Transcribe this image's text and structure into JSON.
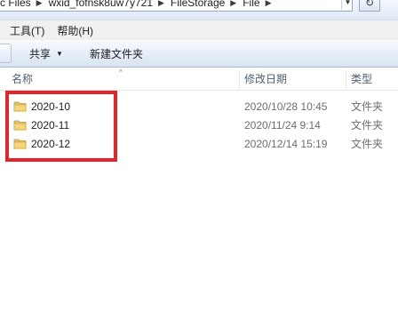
{
  "address": {
    "crumbs": [
      "c Files",
      "wxid_fofnsk8uw7y721",
      "FileStorage",
      "File"
    ],
    "dropdown_glyph": "▼",
    "refresh_glyph": "↻"
  },
  "menu": {
    "edge": "",
    "items": [
      "工具(T)",
      "帮助(H)"
    ]
  },
  "toolbar": {
    "share_label": "共享",
    "share_arrow": "▼",
    "new_folder_label": "新建文件夹"
  },
  "columns": {
    "name": "名称",
    "date": "修改日期",
    "type": "类型",
    "sort_glyph": "^"
  },
  "files": [
    {
      "name": "2020-10",
      "date": "2020/10/28 10:45",
      "type": "文件夹"
    },
    {
      "name": "2020-11",
      "date": "2020/11/24 9:14",
      "type": "文件夹"
    },
    {
      "name": "2020-12",
      "date": "2020/12/14 15:19",
      "type": "文件夹"
    }
  ],
  "colors": {
    "highlight_border": "#e0262a",
    "folder": "#e9c25a"
  }
}
